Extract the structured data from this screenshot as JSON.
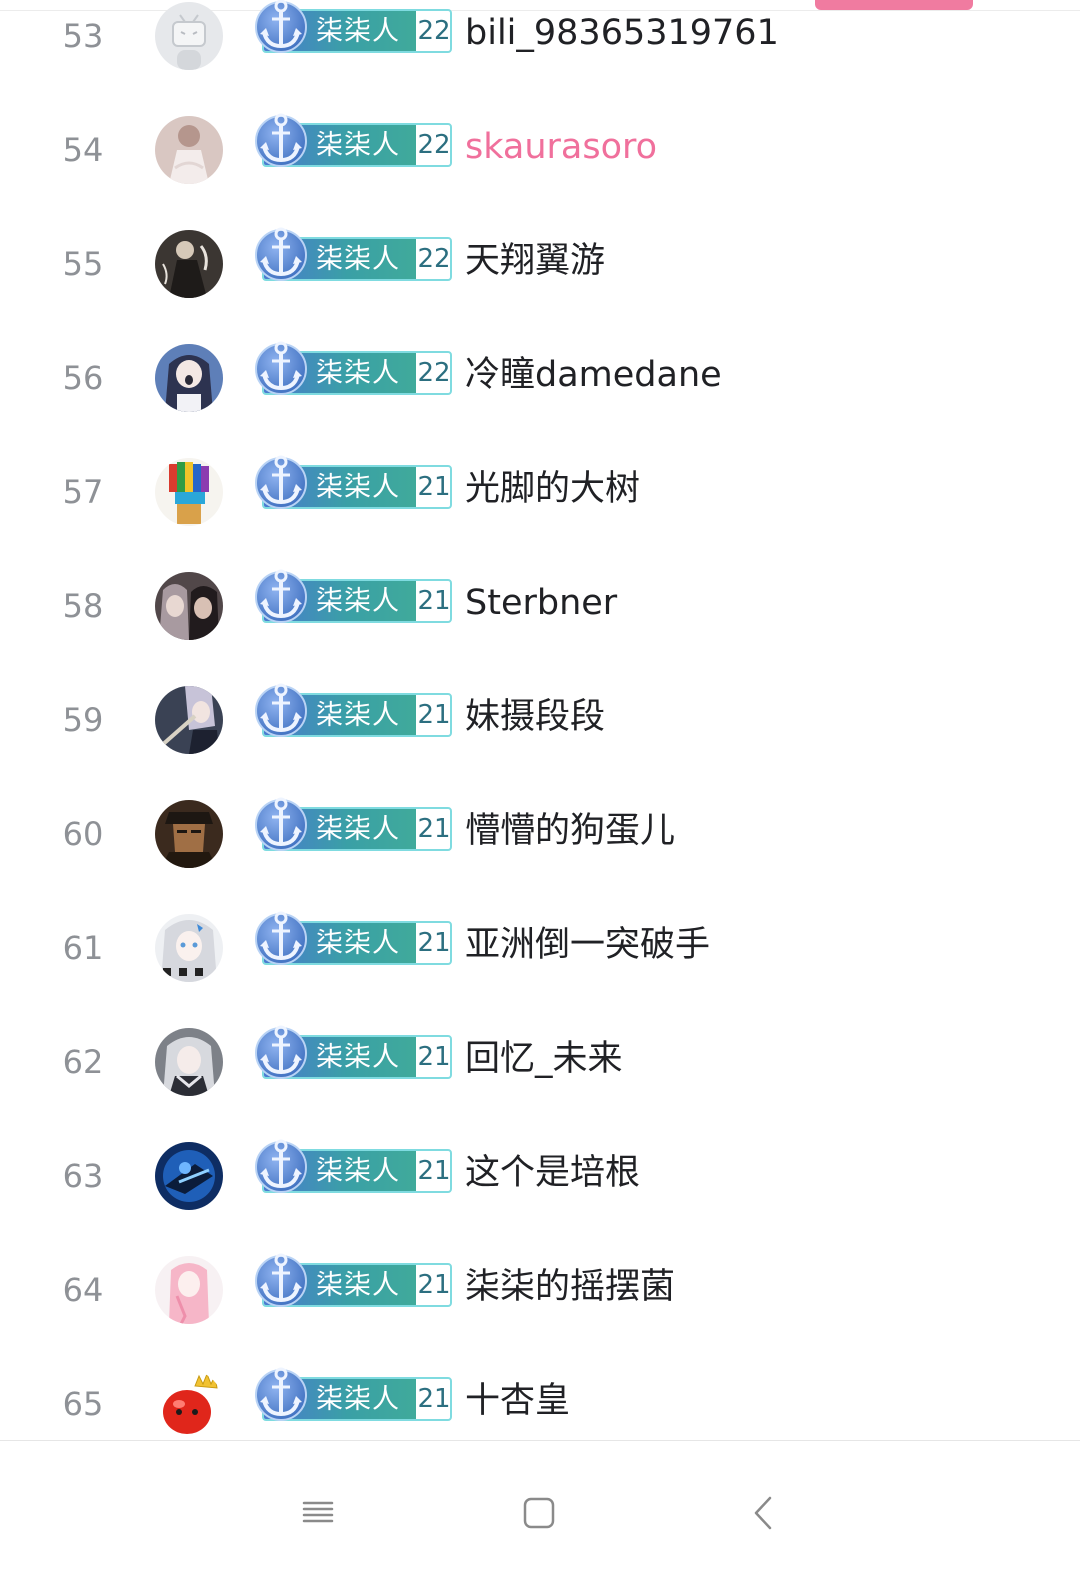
{
  "colors": {
    "accent_pink": "#f07ba0",
    "name_pink": "#f0709c",
    "badge_teal": "#3aa0a6",
    "badge_border": "#7fdbe0",
    "rank_gray": "#8e9196"
  },
  "badge_icon": "anchor-icon",
  "rows": [
    {
      "rank": "53",
      "medal": "柒柒人",
      "level": "22",
      "name": "bili_98365319761",
      "avatar": "bilibili-default-avatar",
      "highlight": false
    },
    {
      "rank": "54",
      "medal": "柒柒人",
      "level": "22",
      "name": "skaurasoro",
      "avatar": "white-dress-avatar",
      "highlight": true
    },
    {
      "rank": "55",
      "medal": "柒柒人",
      "level": "22",
      "name": "天翔翼游",
      "avatar": "dark-figure-avatar",
      "highlight": false
    },
    {
      "rank": "56",
      "medal": "柒柒人",
      "level": "22",
      "name": "冷瞳damedane",
      "avatar": "anime-girl-avatar",
      "highlight": false
    },
    {
      "rank": "57",
      "medal": "柒柒人",
      "level": "21",
      "name": "光脚的大树",
      "avatar": "colorful-fist-avatar",
      "highlight": false
    },
    {
      "rank": "58",
      "medal": "柒柒人",
      "level": "21",
      "name": "Sterbner",
      "avatar": "two-characters-avatar",
      "highlight": false
    },
    {
      "rank": "59",
      "medal": "柒柒人",
      "level": "21",
      "name": "妹摄段段",
      "avatar": "anime-guitar-avatar",
      "highlight": false
    },
    {
      "rank": "60",
      "medal": "柒柒人",
      "level": "21",
      "name": "懵懵的狗蛋儿",
      "avatar": "jojo-avatar",
      "highlight": false
    },
    {
      "rank": "61",
      "medal": "柒柒人",
      "level": "21",
      "name": "亚洲倒一突破手",
      "avatar": "white-hair-girl-avatar",
      "highlight": false
    },
    {
      "rank": "62",
      "medal": "柒柒人",
      "level": "21",
      "name": "回忆_未来",
      "avatar": "silver-hair-girl-avatar",
      "highlight": false
    },
    {
      "rank": "63",
      "medal": "柒柒人",
      "level": "21",
      "name": "这个是培根",
      "avatar": "blue-warrior-avatar",
      "highlight": false
    },
    {
      "rank": "64",
      "medal": "柒柒人",
      "level": "21",
      "name": "柒柒的摇摆菌",
      "avatar": "pink-hair-girl-avatar",
      "highlight": false
    },
    {
      "rank": "65",
      "medal": "柒柒人",
      "level": "21",
      "name": "十杏皇",
      "avatar": "red-apple-crown-avatar",
      "highlight": false
    }
  ],
  "navbar": {
    "menu_icon": "menu-icon",
    "home_icon": "home-square-icon",
    "back_icon": "back-chevron-icon"
  }
}
